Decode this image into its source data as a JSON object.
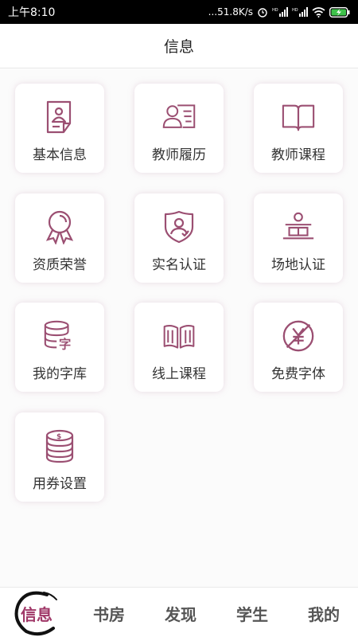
{
  "status_bar": {
    "time": "上午8:10",
    "speed": "...51.8K/s",
    "hd1": "HD",
    "hd2": "HD"
  },
  "header": {
    "title": "信息"
  },
  "colors": {
    "accent": "#9b4f72",
    "tab_active": "#a03868"
  },
  "grid": [
    {
      "label": "基本信息",
      "icon": "profile-card-icon"
    },
    {
      "label": "教师履历",
      "icon": "resume-icon"
    },
    {
      "label": "教师课程",
      "icon": "open-book-icon"
    },
    {
      "label": "资质荣誉",
      "icon": "medal-icon"
    },
    {
      "label": "实名认证",
      "icon": "shield-id-icon"
    },
    {
      "label": "场地认证",
      "icon": "venue-icon"
    },
    {
      "label": "我的字库",
      "icon": "font-database-icon"
    },
    {
      "label": "线上课程",
      "icon": "online-course-icon"
    },
    {
      "label": "免费字体",
      "icon": "free-yen-icon"
    },
    {
      "label": "用券设置",
      "icon": "coupon-coins-icon"
    }
  ],
  "icon_text": {
    "database_char": "字",
    "coin_symbol": "$"
  },
  "tabs": [
    {
      "label": "信息",
      "active": true
    },
    {
      "label": "书房",
      "active": false
    },
    {
      "label": "发现",
      "active": false
    },
    {
      "label": "学生",
      "active": false
    },
    {
      "label": "我的",
      "active": false
    }
  ]
}
